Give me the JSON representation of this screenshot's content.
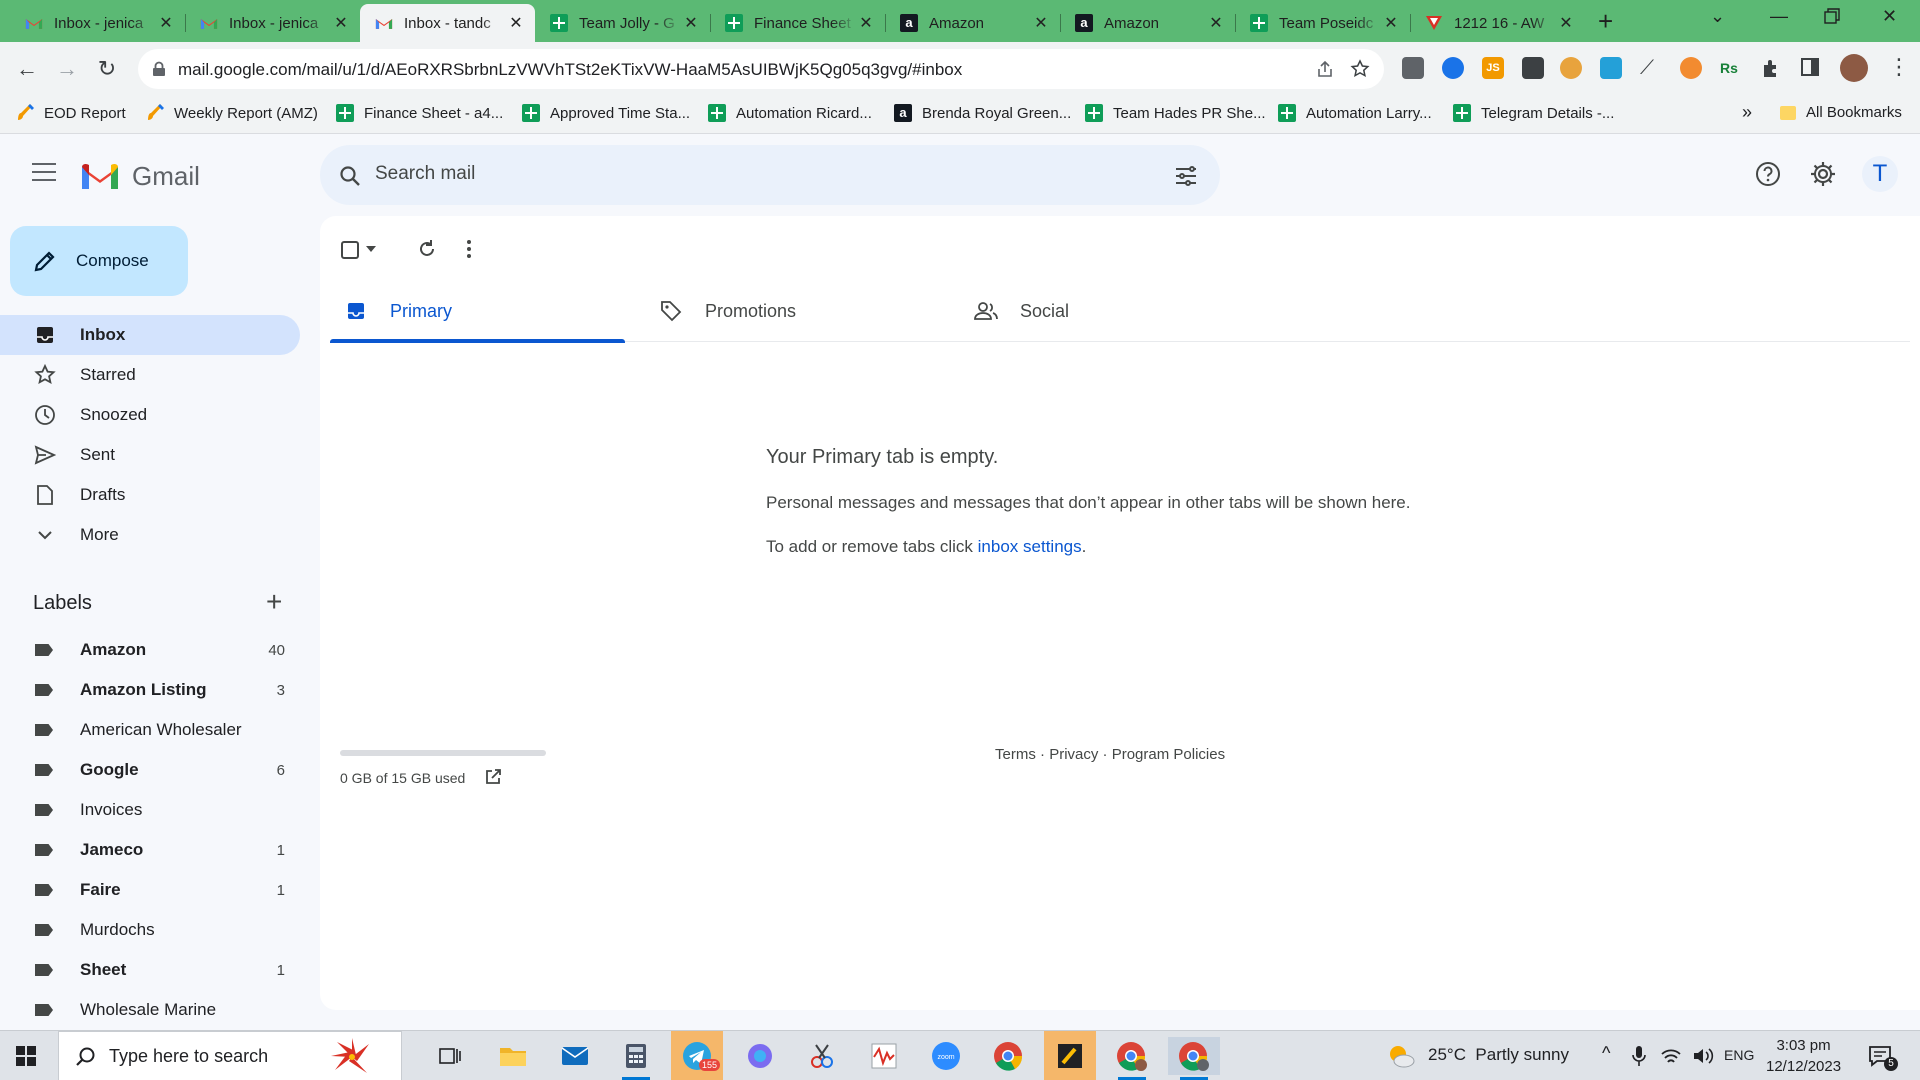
{
  "browser": {
    "tabs": [
      {
        "title": "Inbox - jenica",
        "icon": "gmail-icon",
        "active": false
      },
      {
        "title": "Inbox - jenica",
        "icon": "gmail-icon",
        "active": false
      },
      {
        "title": "Inbox - tandc",
        "icon": "gmail-icon",
        "active": true
      },
      {
        "title": "Team Jolly - G",
        "icon": "sheets-icon",
        "active": false
      },
      {
        "title": "Finance Sheet",
        "icon": "sheets-icon",
        "active": false
      },
      {
        "title": "Amazon",
        "icon": "amazon-icon",
        "active": false
      },
      {
        "title": "Amazon",
        "icon": "amazon-icon",
        "active": false
      },
      {
        "title": "Team Poseidc",
        "icon": "sheets-icon",
        "active": false
      },
      {
        "title": "1212 16 - AW",
        "icon": "red-v-icon",
        "active": false
      }
    ],
    "url": "mail.google.com/mail/u/1/d/AEoRXRSbrbnLzVWVhTSt2eKTixVW-HaaM5AsUIBWjK5Qg05q3gvg/#inbox",
    "bookmarks": [
      {
        "label": "EOD Report",
        "icon": "brush-icon"
      },
      {
        "label": "Weekly Report (AMZ)",
        "icon": "brush-icon"
      },
      {
        "label": "Finance Sheet - a4...",
        "icon": "sheets-icon"
      },
      {
        "label": "Approved Time Sta...",
        "icon": "sheets-icon"
      },
      {
        "label": "Automation Ricard...",
        "icon": "sheets-icon"
      },
      {
        "label": "Brenda Royal Green...",
        "icon": "amazon-icon"
      },
      {
        "label": "Team Hades PR She...",
        "icon": "sheets-icon"
      },
      {
        "label": "Automation Larry...",
        "icon": "sheets-icon"
      },
      {
        "label": "Telegram Details -...",
        "icon": "sheets-icon"
      }
    ],
    "more_bookmarks": "»",
    "all_bookmarks": "All Bookmarks",
    "tab_strip_color": "#5bb974"
  },
  "gmail": {
    "logo_text": "Gmail",
    "search_placeholder": "Search mail",
    "avatar_letter": "T",
    "compose_label": "Compose",
    "nav": [
      {
        "label": "Inbox",
        "icon": "inbox-icon",
        "active": true
      },
      {
        "label": "Starred",
        "icon": "star-icon",
        "active": false
      },
      {
        "label": "Snoozed",
        "icon": "clock-icon",
        "active": false
      },
      {
        "label": "Sent",
        "icon": "send-icon",
        "active": false
      },
      {
        "label": "Drafts",
        "icon": "draft-icon",
        "active": false
      },
      {
        "label": "More",
        "icon": "chevron-down-icon",
        "active": false
      }
    ],
    "labels_title": "Labels",
    "labels": [
      {
        "name": "Amazon",
        "count": "40",
        "bold": true
      },
      {
        "name": "Amazon Listing",
        "count": "3",
        "bold": true
      },
      {
        "name": "American Wholesaler",
        "count": "",
        "bold": false
      },
      {
        "name": "Google",
        "count": "6",
        "bold": true
      },
      {
        "name": "Invoices",
        "count": "",
        "bold": false
      },
      {
        "name": "Jameco",
        "count": "1",
        "bold": true
      },
      {
        "name": "Faire",
        "count": "1",
        "bold": true
      },
      {
        "name": "Murdochs",
        "count": "",
        "bold": false
      },
      {
        "name": "Sheet",
        "count": "1",
        "bold": true
      },
      {
        "name": "Wholesale Marine",
        "count": "",
        "bold": false
      }
    ],
    "tabs": [
      {
        "label": "Primary",
        "icon": "inbox-icon",
        "active": true
      },
      {
        "label": "Promotions",
        "icon": "tag-icon",
        "active": false
      },
      {
        "label": "Social",
        "icon": "people-icon",
        "active": false
      }
    ],
    "empty_title": "Your Primary tab is empty.",
    "empty_desc": "Personal messages and messages that don’t appear in other tabs will be shown here.",
    "empty_tabs_prefix": "To add or remove tabs click ",
    "empty_tabs_link": "inbox settings",
    "empty_tabs_suffix": ".",
    "storage_text": "0 GB of 15 GB used",
    "storage_fraction": 0.0,
    "footer": {
      "terms": "Terms",
      "sep1": " · ",
      "privacy": "Privacy",
      "sep2": " · ",
      "policies": "Program Policies"
    },
    "accent_color": "#0b57d0"
  },
  "taskbar": {
    "search_placeholder": "Type here to search",
    "telegram_badge": "155",
    "weather": "25°C  Partly sunny",
    "language": "ENG",
    "time": "3:03 pm",
    "date": "12/12/2023",
    "notification_count": "5"
  }
}
